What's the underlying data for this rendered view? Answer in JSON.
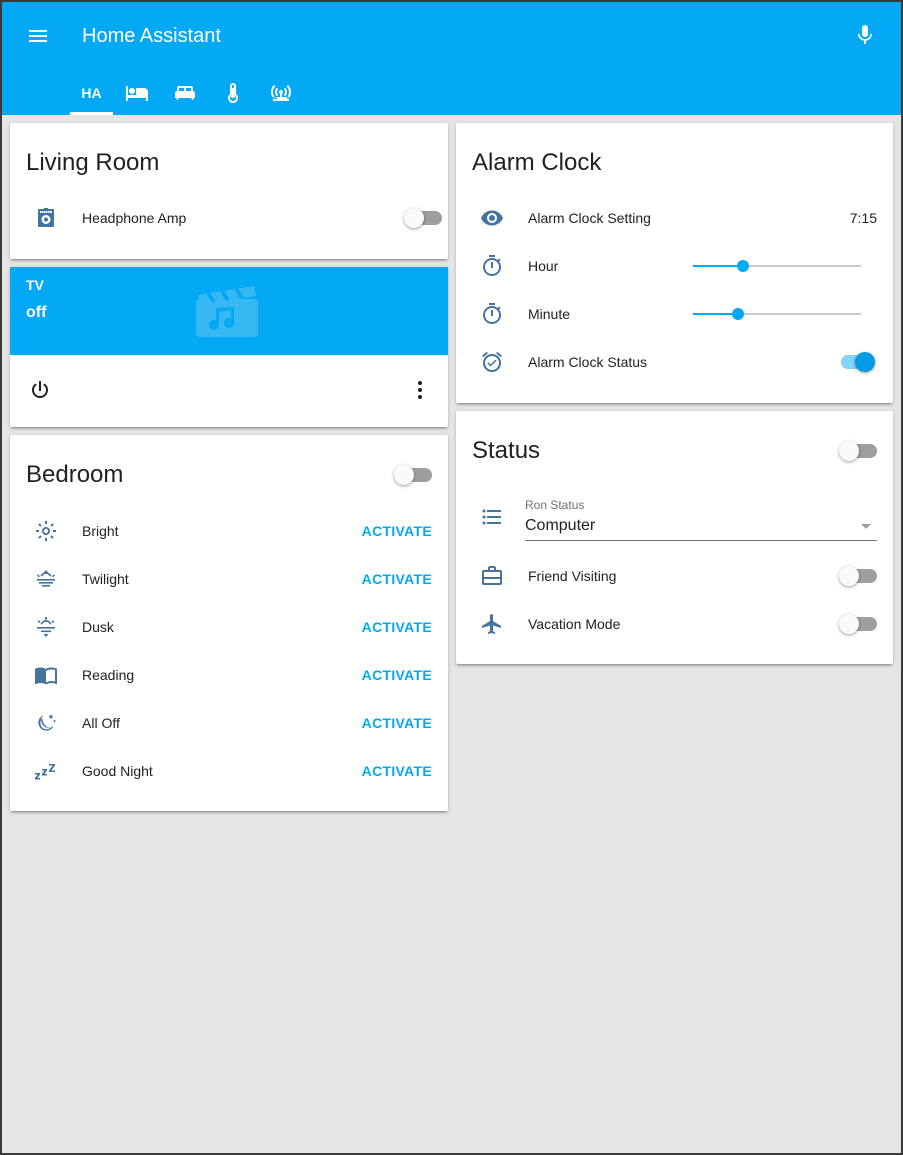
{
  "app": {
    "title": "Home Assistant"
  },
  "header": {
    "tabs": [
      {
        "label": "HA",
        "active": true
      },
      {
        "icon": "bed-single-icon"
      },
      {
        "icon": "bed-double-icon"
      },
      {
        "icon": "thermometer-icon"
      },
      {
        "icon": "router-wireless-icon"
      }
    ]
  },
  "colors": {
    "primary": "#03a9f4",
    "toggle_on": "#039be5",
    "icon": "#44739e",
    "background": "#e5e5e5"
  },
  "living_room": {
    "title": "Living Room",
    "rows": [
      {
        "label": "Headphone Amp",
        "icon": "amplifier-icon",
        "on": false
      }
    ]
  },
  "media": {
    "name": "TV",
    "state": "off"
  },
  "bedroom": {
    "title": "Bedroom",
    "master_on": false,
    "scenes": [
      {
        "label": "Bright",
        "icon": "brightness-icon",
        "action": "ACTIVATE"
      },
      {
        "label": "Twilight",
        "icon": "weather-sunset-icon",
        "action": "ACTIVATE"
      },
      {
        "label": "Dusk",
        "icon": "weather-sunset-down-icon",
        "action": "ACTIVATE"
      },
      {
        "label": "Reading",
        "icon": "book-open-icon",
        "action": "ACTIVATE"
      },
      {
        "label": "All Off",
        "icon": "moon-stars-icon",
        "action": "ACTIVATE"
      },
      {
        "label": "Good Night",
        "icon": "sleep-icon",
        "action": "ACTIVATE"
      }
    ]
  },
  "alarm_clock": {
    "title": "Alarm Clock",
    "setting": {
      "label": "Alarm Clock Setting",
      "value": "7:15"
    },
    "hour": {
      "label": "Hour",
      "fraction": 0.3
    },
    "minute": {
      "label": "Minute",
      "fraction": 0.27
    },
    "status": {
      "label": "Alarm Clock Status",
      "on": true
    }
  },
  "status": {
    "title": "Status",
    "master_on": false,
    "ron_status": {
      "label": "Ron Status",
      "value": "Computer"
    },
    "friend_visiting": {
      "label": "Friend Visiting",
      "on": false
    },
    "vacation_mode": {
      "label": "Vacation Mode",
      "on": false
    }
  }
}
